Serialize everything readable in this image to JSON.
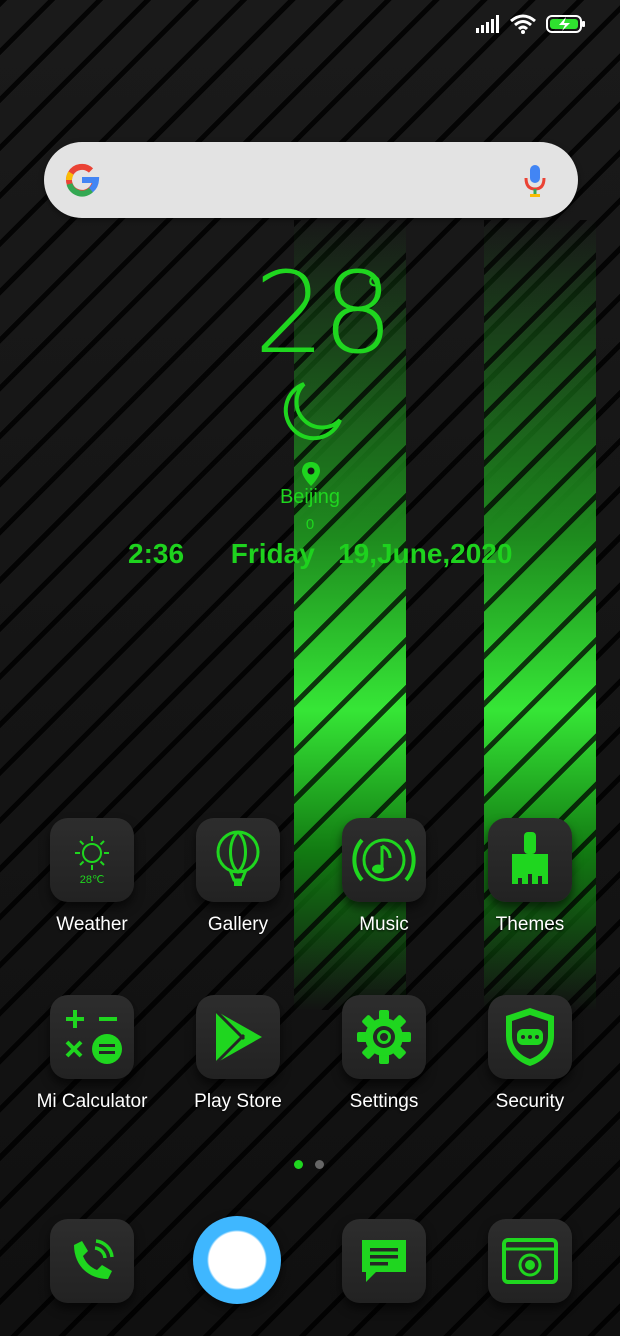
{
  "status": {
    "icons": [
      "signal-icon",
      "wifi-icon",
      "battery-charging-icon"
    ]
  },
  "search": {
    "logo": "google-logo-icon",
    "mic": "microphone-icon"
  },
  "weather_widget": {
    "temperature": "28",
    "unit": "°",
    "condition_icon": "moon-icon",
    "city": "Beijing",
    "sub_value": "0",
    "time": "2:36",
    "day": "Friday",
    "date": "19,June,2020",
    "accent": "#1fd61f"
  },
  "apps": {
    "row1": [
      {
        "label": "Weather",
        "icon": "sun-icon",
        "icon_text": "28℃"
      },
      {
        "label": "Gallery",
        "icon": "balloon-icon"
      },
      {
        "label": "Music",
        "icon": "music-note-icon"
      },
      {
        "label": "Themes",
        "icon": "paint-brush-icon"
      }
    ],
    "row2": [
      {
        "label": "Mi Calculator",
        "icon": "calculator-icon"
      },
      {
        "label": "Play Store",
        "icon": "play-triangle-icon"
      },
      {
        "label": "Settings",
        "icon": "gear-icon"
      },
      {
        "label": "Security",
        "icon": "shield-icon"
      }
    ]
  },
  "pages": {
    "count": 2,
    "active": 1
  },
  "dock": [
    {
      "icon": "phone-icon"
    },
    {
      "icon": "browser-icon"
    },
    {
      "icon": "message-icon"
    },
    {
      "icon": "screen-recorder-icon"
    }
  ]
}
